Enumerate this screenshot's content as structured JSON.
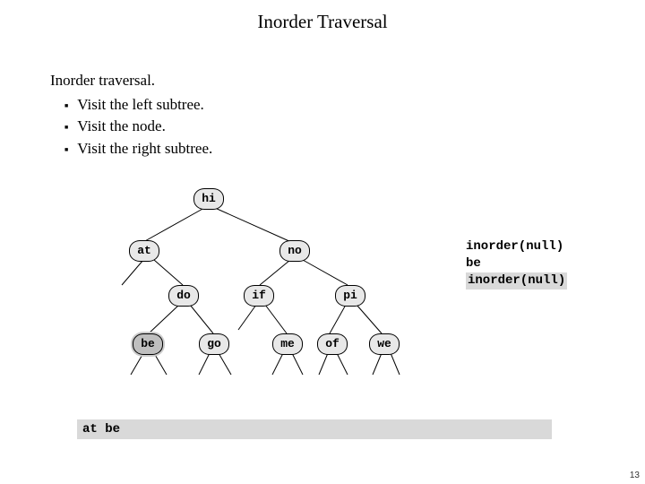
{
  "title": "Inorder Traversal",
  "heading": "Inorder traversal.",
  "bullets": [
    "Visit the left subtree.",
    "Visit the node.",
    "Visit the right subtree."
  ],
  "tree": {
    "hi": "hi",
    "at": "at",
    "no": "no",
    "do": "do",
    "if": "if",
    "pi": "pi",
    "be": "be",
    "go": "go",
    "me": "me",
    "of": "of",
    "we": "we"
  },
  "stack": {
    "line1": "inorder(null)",
    "line2": "be",
    "line3": "inorder(null)"
  },
  "output": "at be",
  "page_number": "13"
}
